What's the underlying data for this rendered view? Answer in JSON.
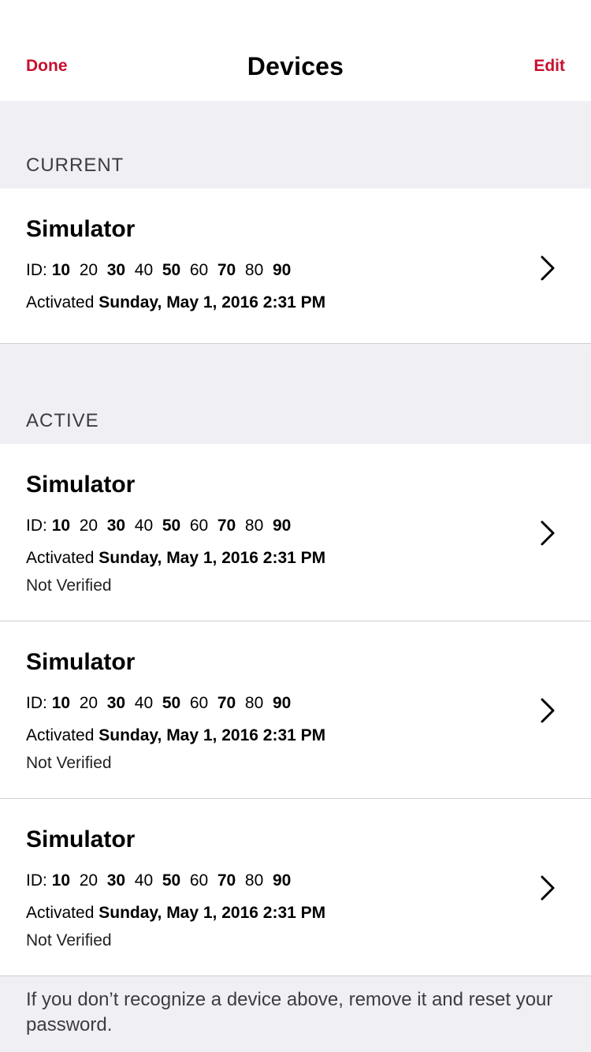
{
  "nav": {
    "done_label": "Done",
    "title": "Devices",
    "edit_label": "Edit"
  },
  "sections": {
    "current_header": "CURRENT",
    "active_header": "ACTIVE"
  },
  "devices": [
    {
      "name": "Simulator",
      "id_prefix": "ID:",
      "id_groups": [
        "10",
        "20",
        "30",
        "40",
        "50",
        "60",
        "70",
        "80",
        "90"
      ],
      "activated_label": "Activated",
      "activated_date": "Sunday, May 1, 2016 2:31 PM",
      "status": ""
    },
    {
      "name": "Simulator",
      "id_prefix": "ID:",
      "id_groups": [
        "10",
        "20",
        "30",
        "40",
        "50",
        "60",
        "70",
        "80",
        "90"
      ],
      "activated_label": "Activated",
      "activated_date": "Sunday, May 1, 2016 2:31 PM",
      "status": "Not Verified"
    },
    {
      "name": "Simulator",
      "id_prefix": "ID:",
      "id_groups": [
        "10",
        "20",
        "30",
        "40",
        "50",
        "60",
        "70",
        "80",
        "90"
      ],
      "activated_label": "Activated",
      "activated_date": "Sunday, May 1, 2016 2:31 PM",
      "status": "Not Verified"
    },
    {
      "name": "Simulator",
      "id_prefix": "ID:",
      "id_groups": [
        "10",
        "20",
        "30",
        "40",
        "50",
        "60",
        "70",
        "80",
        "90"
      ],
      "activated_label": "Activated",
      "activated_date": "Sunday, May 1, 2016 2:31 PM",
      "status": "Not Verified"
    }
  ],
  "footer": {
    "note": "If you don’t recognize a device above, remove it and reset your password."
  },
  "colors": {
    "accent": "#c8102e",
    "background": "#efeff4",
    "cell": "#ffffff"
  },
  "icons": {
    "disclosure": "chevron-right-icon"
  }
}
